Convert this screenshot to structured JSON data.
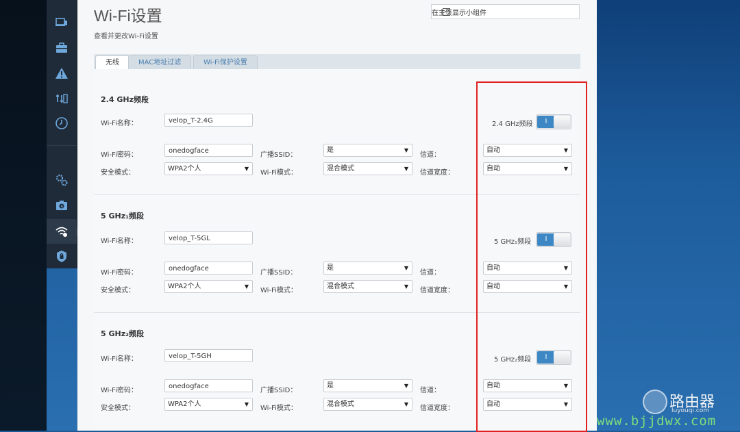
{
  "page": {
    "title": "Wi-Fi设置",
    "subtitle": "查看并更改Wi-Fi设置",
    "widget_label": "在主页显示小组件",
    "widget_checked": true
  },
  "sidebar": {
    "items": [
      {
        "icon": "devices-icon"
      },
      {
        "icon": "toolbox-icon"
      },
      {
        "icon": "alert-icon"
      },
      {
        "icon": "transfer-icon"
      },
      {
        "icon": "clock-icon"
      },
      {
        "icon": "gear-icon"
      },
      {
        "icon": "backup-icon"
      },
      {
        "icon": "wifi-icon",
        "active": true
      },
      {
        "icon": "shield-icon"
      }
    ]
  },
  "tabs": [
    {
      "label": "无线",
      "active": true
    },
    {
      "label": "MAC地址过滤"
    },
    {
      "label": "Wi-Fi保护设置"
    }
  ],
  "labels": {
    "ssid": "Wi-Fi名称：",
    "password": "Wi-Fi密码：",
    "security": "安全模式：",
    "broadcast": "广播SSID：",
    "mode": "Wi-Fi模式：",
    "channel": "信道：",
    "width": "信道宽度："
  },
  "bands": [
    {
      "title": "2.4 GHz频段",
      "toggle_label": "2.4 GHz频段",
      "toggle_on": "I",
      "ssid": "velop_T-2.4G",
      "password": "onedogface",
      "security": "WPA2个人",
      "broadcast": "是",
      "mode": "混合模式",
      "channel": "自动",
      "width": "自动"
    },
    {
      "title": "5 GHz₁频段",
      "toggle_label": "5 GHz₁频段",
      "toggle_on": "I",
      "ssid": "velop_T-5GL",
      "password": "onedogface",
      "security": "WPA2个人",
      "broadcast": "是",
      "mode": "混合模式",
      "channel": "自动",
      "width": "自动"
    },
    {
      "title": "5 GHz₂频段",
      "toggle_label": "5 GHz₂频段",
      "toggle_on": "I",
      "ssid": "velop_T-5GH",
      "password": "onedogface",
      "security": "WPA2个人",
      "broadcast": "是",
      "mode": "混合模式",
      "channel": "自动",
      "width": "自动"
    }
  ],
  "watermark": {
    "brand": "路由器",
    "brand_sub": "luyouqi.com",
    "url": "www.bjjdwx.com"
  },
  "colors": {
    "accent": "#3d87c4",
    "highlight_box": "#e02020",
    "watermark_url": "#7ce07c"
  }
}
